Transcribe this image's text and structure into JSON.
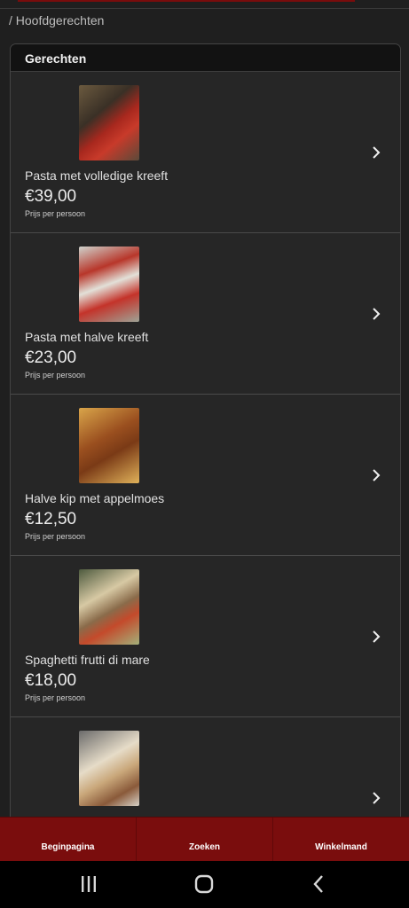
{
  "breadcrumb": "/ Hoofdgerechten",
  "panel": {
    "title": "Gerechten"
  },
  "dishes": [
    {
      "name": "Pasta met volledige kreeft",
      "price": "€39,00",
      "unit": "Prijs per persoon",
      "image": "lobster-pasta-photo"
    },
    {
      "name": "Pasta met halve kreeft",
      "price": "€23,00",
      "unit": "Prijs per persoon",
      "image": "half-lobster-pasta-photo"
    },
    {
      "name": "Halve kip met appelmoes",
      "price": "€12,50",
      "unit": "Prijs per persoon",
      "image": "half-chicken-photo"
    },
    {
      "name": "Spaghetti frutti di mare",
      "price": "€18,00",
      "unit": "Prijs per persoon",
      "image": "seafood-spaghetti-photo"
    },
    {
      "name": "",
      "price": "",
      "unit": "",
      "image": "dish-photo"
    }
  ],
  "bottom_nav": {
    "home": "Beginpagina",
    "search": "Zoeken",
    "cart": "Winkelmand"
  },
  "colors": {
    "accent": "#7a0d0d",
    "background": "#1f1f1f",
    "card": "#262626"
  }
}
